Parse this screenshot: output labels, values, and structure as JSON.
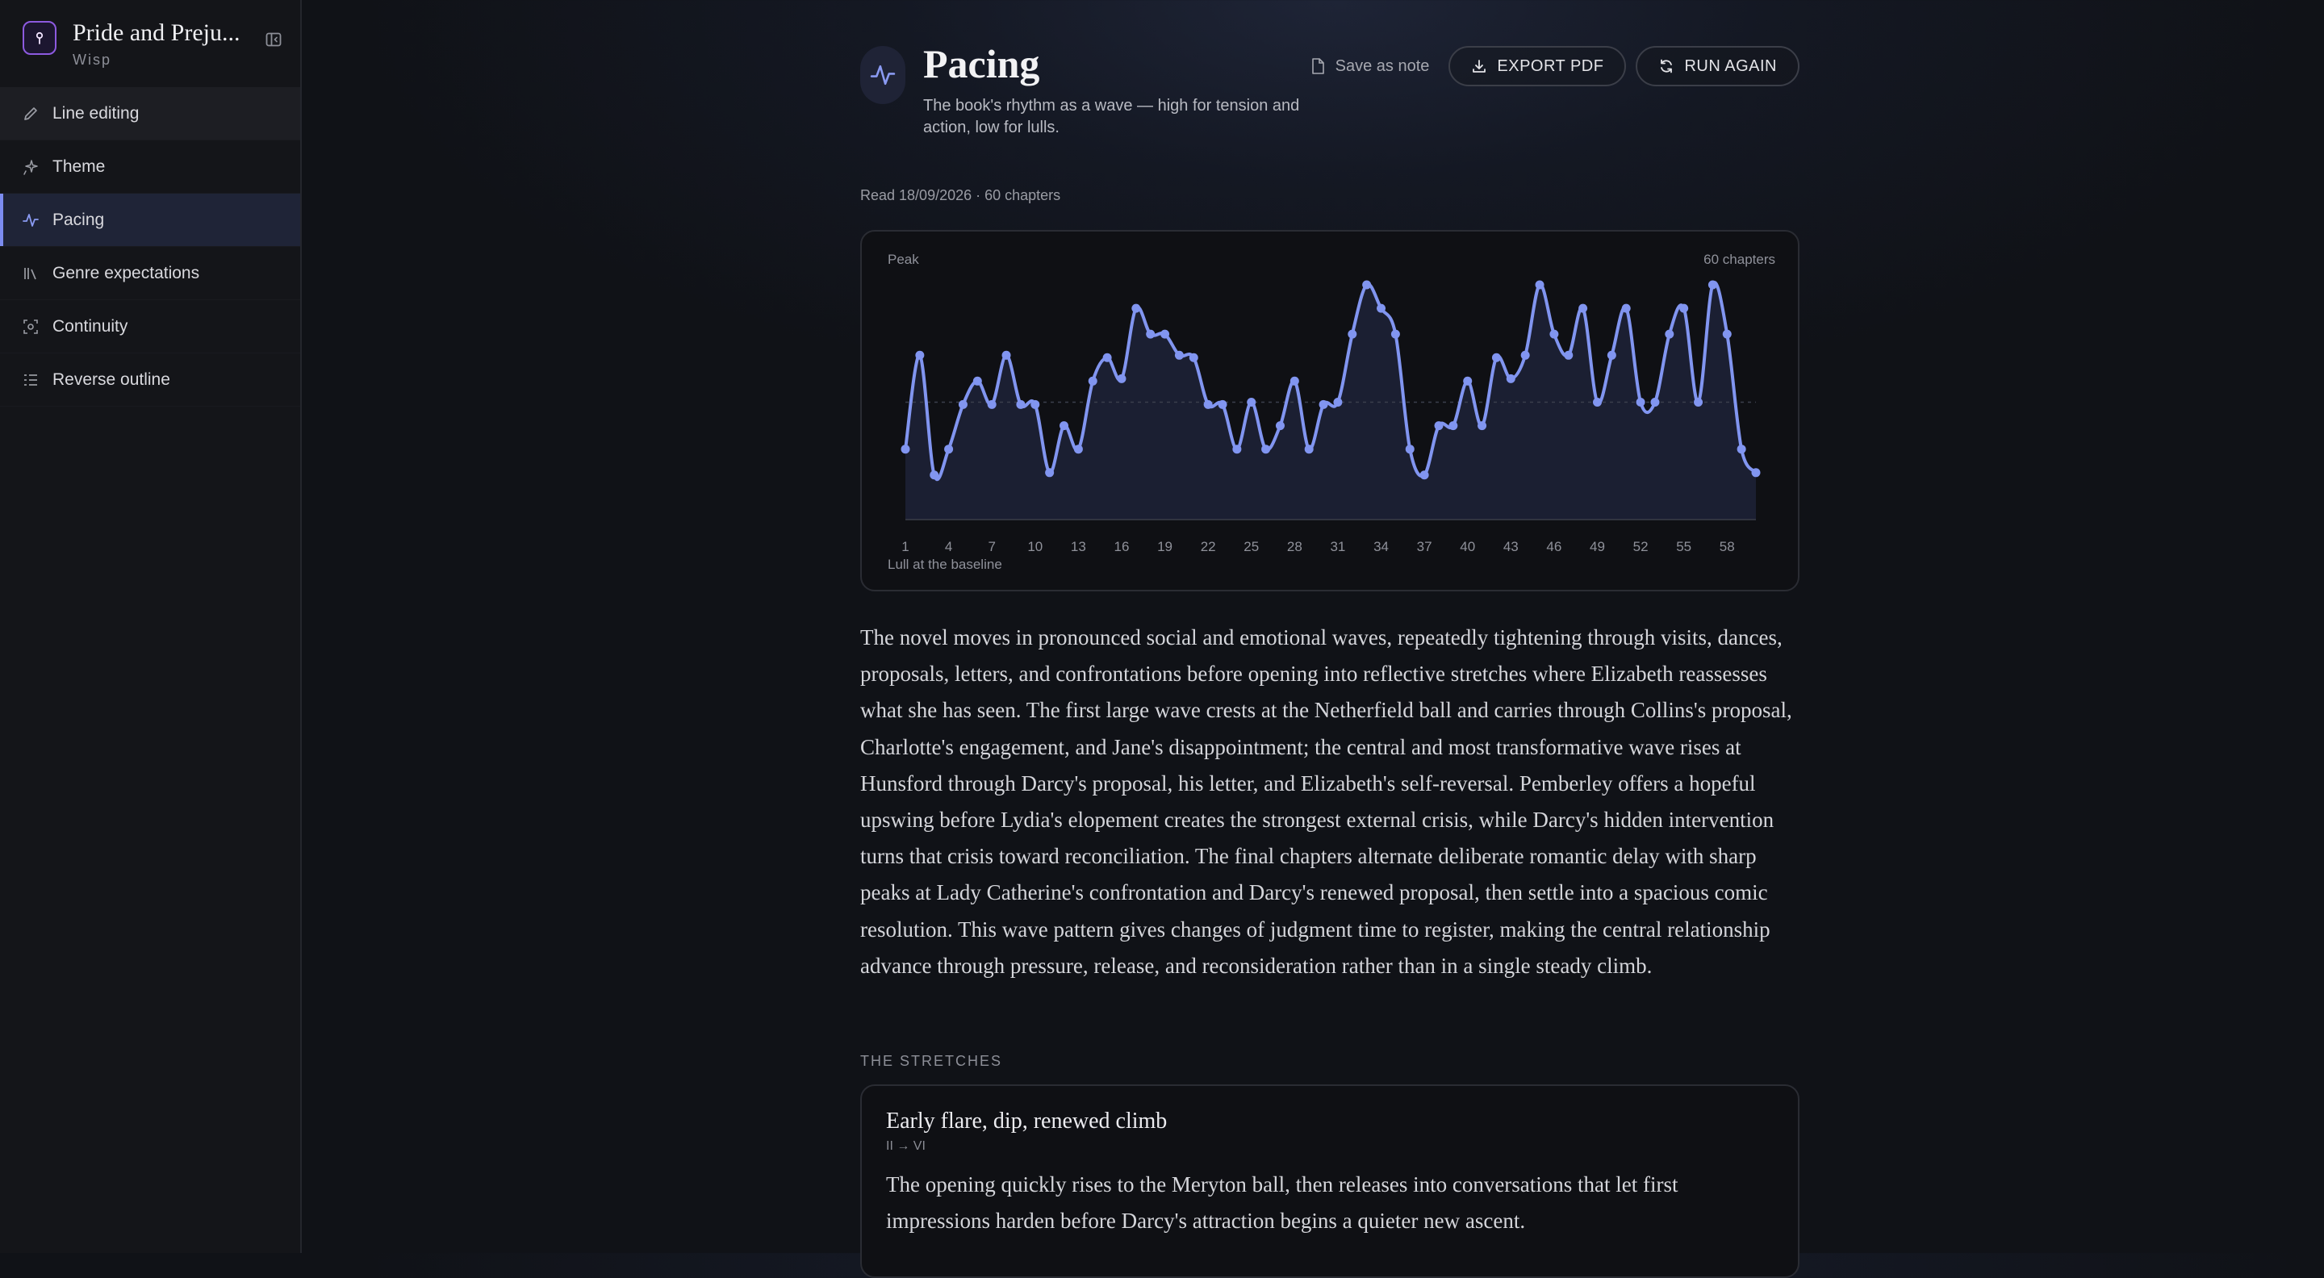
{
  "sidebar": {
    "book_title": "Pride and Preju...",
    "app_name": "Wisp",
    "items": [
      {
        "label": "Line editing",
        "icon": "pencil-icon"
      },
      {
        "label": "Theme",
        "icon": "sparkle-icon"
      },
      {
        "label": "Pacing",
        "icon": "pulse-icon",
        "active": true
      },
      {
        "label": "Genre expectations",
        "icon": "library-icon"
      },
      {
        "label": "Continuity",
        "icon": "scan-icon"
      },
      {
        "label": "Reverse outline",
        "icon": "list-icon"
      }
    ]
  },
  "header": {
    "title": "Pacing",
    "description": "The book's rhythm as a wave — high for tension and action, low for lulls.",
    "save_label": "Save as note",
    "export_label": "EXPORT PDF",
    "run_label": "RUN AGAIN"
  },
  "meta": "Read 18/09/2026 · 60 chapters",
  "chart_data": {
    "type": "line",
    "top_left_label": "Peak",
    "top_right_label": "60 chapters",
    "bottom_label": "Lull at the baseline",
    "x_ticks": [
      1,
      4,
      7,
      10,
      13,
      16,
      19,
      22,
      25,
      28,
      31,
      34,
      37,
      40,
      43,
      46,
      49,
      52,
      55,
      58
    ],
    "ylim": [
      0,
      1
    ],
    "baseline_dashed": 0.5,
    "series": [
      {
        "x": [
          1,
          2,
          3,
          4,
          5,
          6,
          7,
          8,
          9,
          10,
          11,
          12,
          13,
          14,
          15,
          16,
          17,
          18,
          19,
          20,
          21,
          22,
          23,
          24,
          25,
          26,
          27,
          28,
          29,
          30,
          31,
          32,
          33,
          34,
          35,
          36,
          37,
          38,
          39,
          40,
          41,
          42,
          43,
          44,
          45,
          46,
          47,
          48,
          49,
          50,
          51,
          52,
          53,
          54,
          55,
          56,
          57,
          58,
          59,
          60
        ],
        "values": [
          0.3,
          0.7,
          0.19,
          0.3,
          0.49,
          0.59,
          0.49,
          0.7,
          0.49,
          0.49,
          0.2,
          0.4,
          0.3,
          0.59,
          0.69,
          0.6,
          0.9,
          0.79,
          0.79,
          0.7,
          0.69,
          0.49,
          0.49,
          0.3,
          0.5,
          0.3,
          0.4,
          0.59,
          0.3,
          0.49,
          0.5,
          0.79,
          1.0,
          0.9,
          0.79,
          0.3,
          0.19,
          0.4,
          0.4,
          0.59,
          0.4,
          0.69,
          0.6,
          0.7,
          1.0,
          0.79,
          0.7,
          0.9,
          0.5,
          0.7,
          0.9,
          0.5,
          0.5,
          0.79,
          0.9,
          0.5,
          1.0,
          0.79,
          0.3,
          0.2
        ]
      }
    ]
  },
  "summary": "The novel moves in pronounced social and emotional waves, repeatedly tightening through visits, dances, proposals, letters, and confrontations before opening into reflective stretches where Elizabeth reassesses what she has seen. The first large wave crests at the Netherfield ball and carries through Collins's proposal, Charlotte's engagement, and Jane's disappointment; the central and most transformative wave rises at Hunsford through Darcy's proposal, his letter, and Elizabeth's self-reversal. Pemberley offers a hopeful upswing before Lydia's elopement creates the strongest external crisis, while Darcy's hidden intervention turns that crisis toward reconciliation. The final chapters alternate deliberate romantic delay with sharp peaks at Lady Catherine's confrontation and Darcy's renewed proposal, then settle into a spacious comic resolution. This wave pattern gives changes of judgment time to register, making the central relationship advance through pressure, release, and reconsideration rather than in a single steady climb.",
  "stretches": {
    "heading": "THE STRETCHES",
    "items": [
      {
        "title": "Early flare, dip, renewed climb",
        "range": "II → VI",
        "body": "The opening quickly rises to the Meryton ball, then releases into conversations that let first impressions harden before Darcy's attraction begins a quieter new ascent."
      }
    ]
  },
  "colors": {
    "accent": "#7c8cf0",
    "line": "#8195f0",
    "area": "#1c2134",
    "background": "#101217"
  }
}
